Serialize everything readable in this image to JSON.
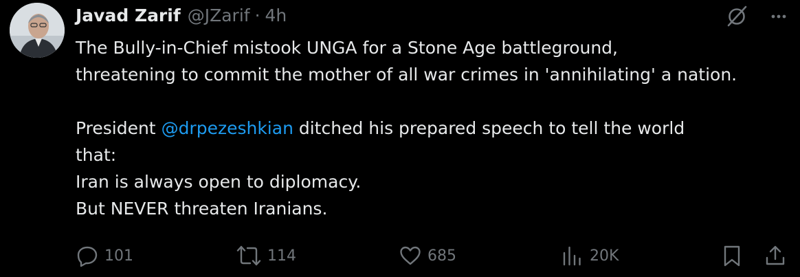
{
  "author": {
    "name": "Javad Zarif",
    "handle": "@JZarif",
    "separator": "·",
    "time": "4h"
  },
  "tweet": {
    "line1": "The Bully-in-Chief mistook UNGA for a Stone Age battleground,",
    "line2": "threatening to commit the mother of all war crimes in 'annihilating' a nation.",
    "line3_prefix": "President ",
    "line3_mention": "@drpezeshkian",
    "line3_suffix": " ditched his prepared speech to tell the world",
    "line4": "that:",
    "line5": "Iran is always open to diplomacy.",
    "line6": "But NEVER threaten Iranians."
  },
  "actions": {
    "replies": "101",
    "reposts": "114",
    "likes": "685",
    "views": "20K"
  },
  "icons": {
    "grok": "grok-icon",
    "more": "more-icon",
    "reply": "reply-icon",
    "repost": "repost-icon",
    "like": "heart-icon",
    "views": "views-icon",
    "bookmark": "bookmark-icon",
    "share": "share-icon"
  },
  "colors": {
    "background": "#000000",
    "text": "#e7e9ea",
    "muted": "#71767b",
    "link": "#1d9bf0"
  }
}
